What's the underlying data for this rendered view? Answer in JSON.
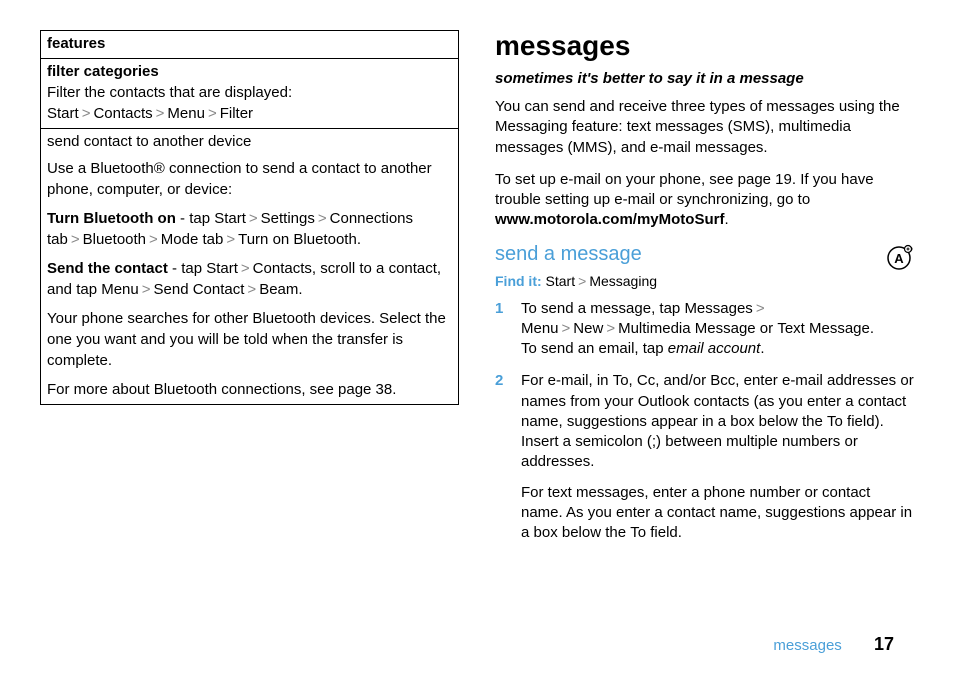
{
  "left": {
    "table": {
      "header": "features",
      "row1": {
        "title": "filter categories",
        "desc": "Filter the contacts that are displayed:",
        "path": [
          "Start",
          "Contacts",
          "Menu",
          "Filter"
        ]
      },
      "row2": {
        "title": "send contact to another device",
        "desc": "Use a Bluetooth® connection to send a contact to another phone, computer, or device:",
        "bt_on_label": "Turn Bluetooth on",
        "bt_on_pre": " - tap ",
        "bt_on_path_a": [
          "Start",
          "Settings",
          "Connections"
        ],
        "bt_on_mid1": " tab",
        "bt_on_path_b": [
          "Bluetooth",
          "Mode"
        ],
        "bt_on_mid2": " tab",
        "bt_on_path_c": [
          "Turn on Bluetooth"
        ],
        "bt_on_end": ".",
        "send_label": "Send the contact",
        "send_pre": " - tap ",
        "send_path_a": [
          "Start",
          "Contacts"
        ],
        "send_mid": ", scroll to a contact, and tap ",
        "send_path_b": [
          "Menu",
          "Send Contact",
          "Beam"
        ],
        "send_end": ".",
        "result": "Your phone searches for other Bluetooth devices. Select the one you want and you will be told when the transfer is complete.",
        "more": "For more about Bluetooth connections, see page 38."
      }
    }
  },
  "right": {
    "heading": "messages",
    "tagline": "sometimes it's better to say it in a message",
    "intro_a": "You can send and receive three types of messages using the ",
    "intro_feature": "Messaging",
    "intro_b": " feature: text messages (SMS), multimedia messages (MMS), and e-mail messages.",
    "setup_a": "To set up e-mail on your phone, see page 19. If you have trouble setting up e-mail or synchronizing, go to ",
    "setup_url": "www.motorola.com/myMotoSurf",
    "setup_b": ".",
    "subheading": "send a message",
    "findit_label": "Find it:",
    "findit_path": [
      "Start",
      "Messaging"
    ],
    "steps": [
      {
        "num": "1",
        "p1_a": "To send a message, tap ",
        "p1_path_a": [
          "Messages",
          "Menu",
          "New"
        ],
        "p1_path_b": "Multimedia Message",
        "p1_or": " or ",
        "p1_path_c": "Text Message",
        "p1_b": ".",
        "p2_a": "To send an email, tap ",
        "p2_ital": "email account",
        "p2_b": "."
      },
      {
        "num": "2",
        "p1_a": "For e-mail, in ",
        "p1_to": "To",
        "p1_b": ", ",
        "p1_cc": "Cc",
        "p1_c": ", and/or ",
        "p1_bcc": "Bcc",
        "p1_d": ", enter e-mail addresses or names from your Outlook contacts (as you enter a contact name, suggestions appear in a box below the ",
        "p1_to2": "To",
        "p1_e": " field). Insert a semicolon (;) between multiple numbers or addresses.",
        "p2_a": "For text messages, enter a phone number or contact name. As you enter a contact name, suggestions appear in a box below the ",
        "p2_to": "To",
        "p2_b": " field."
      }
    ]
  },
  "footer": {
    "label": "messages",
    "page": "17"
  }
}
